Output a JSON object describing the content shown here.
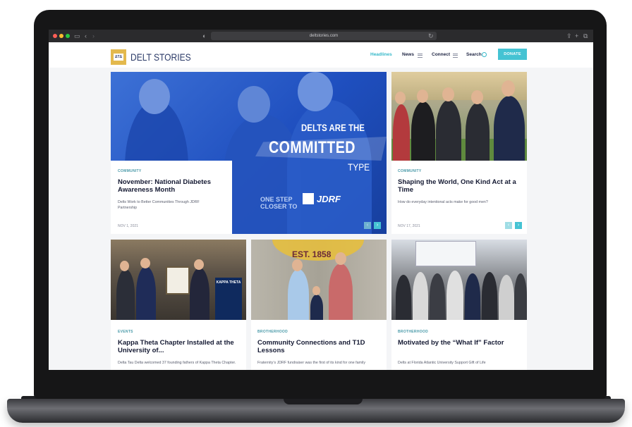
{
  "browser": {
    "url": "deltstories.com"
  },
  "nav": {
    "logo_mark": "ΔTΔ",
    "logo_text": "DELT STORIES",
    "headlines": "Headlines",
    "news": "News",
    "connect": "Connect",
    "search": "Search",
    "donate": "DONATE"
  },
  "hero": {
    "promo_line1": "DELTS ARE THE",
    "promo_line2": "COMMITTED",
    "promo_line3": "TYPE",
    "sponsor": "JDRF",
    "shirt_text": "ONE STEP CLOSER TO",
    "category": "COMMUNITY",
    "title": "November: National Diabetes Awareness Month",
    "description": "Delts Work to Better Communities Through JDRF Partnership",
    "date": "NOV 1, 2021"
  },
  "featured": {
    "category": "COMMUNITY",
    "title": "Shaping the World, One Kind Act at a Time",
    "description": "How do everyday intentional acts make for good men?",
    "date": "NOV 17, 2021"
  },
  "cards": [
    {
      "category": "EVENTS",
      "title": "Kappa Theta Chapter Installed at the University of...",
      "description": "Delta Tau Delta welcomed 37 founding fathers of Kappa Theta Chapter.",
      "banner": "KAPPA THETA"
    },
    {
      "category": "BROTHERHOOD",
      "title": "Community Connections and T1D Lessons",
      "description": "Fraternity’s JDRF fundraiser was the first of its kind for one family",
      "mural": "EST. 1858"
    },
    {
      "category": "BROTHERHOOD",
      "title": "Motivated by the “What If” Factor",
      "description": "Delts at Florida Atlantic University Support Gift of Life"
    }
  ],
  "colors": {
    "accent": "#45c3d3",
    "navy": "#151a33",
    "hero_blue": "#1f4fbf",
    "gold": "#e3b94d"
  }
}
